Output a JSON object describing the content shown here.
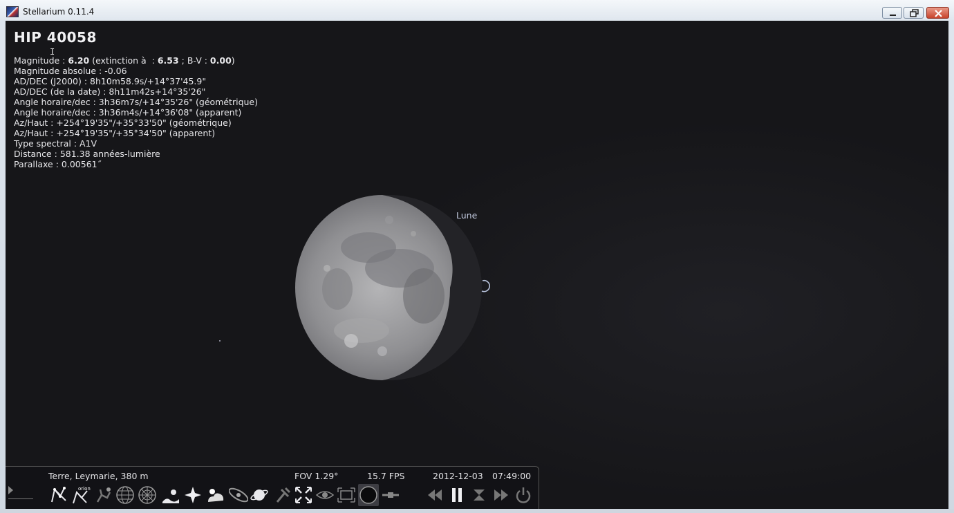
{
  "window": {
    "title": "Stellarium 0.11.4"
  },
  "object_info": {
    "title": "HIP 40058",
    "lines": [
      {
        "pre": "Magnitude : ",
        "b1": "6.20",
        "mid": " (extinction à  : ",
        "b2": "6.53",
        "mid2": " ; B-V : ",
        "b3": "0.00",
        "post": ")"
      },
      {
        "text": "Magnitude absolue : -0.06"
      },
      {
        "text": "AD/DEC (J2000) : 8h10m58.9s/+14°37'45.9\""
      },
      {
        "text": "AD/DEC (de la date) : 8h11m42s+14°35'26\""
      },
      {
        "text": "Angle horaire/dec : 3h36m7s/+14°35'26\" (géométrique)"
      },
      {
        "text": "Angle horaire/dec : 3h36m4s/+14°36'08\" (apparent)"
      },
      {
        "text": "Az/Haut : +254°19'35\"/+35°33'50\" (géométrique)"
      },
      {
        "text": "Az/Haut : +254°19'35\"/+35°34'50\" (apparent)"
      },
      {
        "text": "Type spectral : A1V"
      },
      {
        "text": "Distance : 581.38 années-lumière"
      },
      {
        "text": "Parallaxe : 0.00561˝"
      }
    ]
  },
  "sky": {
    "moon_label": "Lune"
  },
  "status_bar": {
    "location": "Terre, Leymarie, 380 m",
    "fov": "FOV 1.29°",
    "fps": "15.7 FPS",
    "date": "2012-12-03",
    "time": "07:49:00",
    "constellation_art_label": "orion"
  },
  "colors": {
    "sky": "#161619",
    "text": "#e7e7ea",
    "moon_label": "#c3cbe0",
    "button_icon": "#e8e8ec"
  }
}
